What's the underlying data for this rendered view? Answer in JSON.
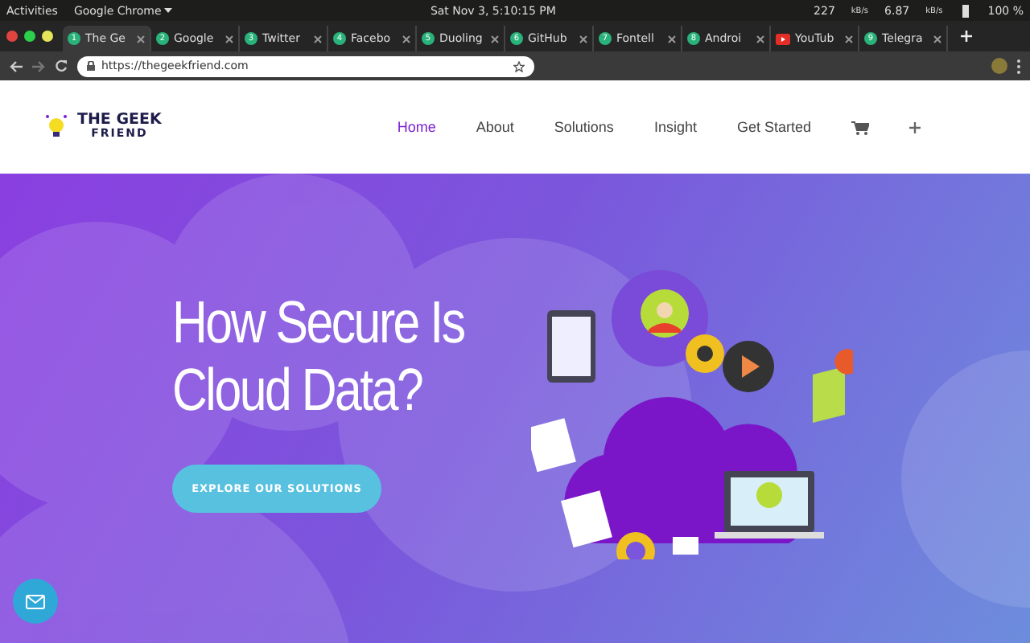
{
  "top_bar": {
    "activities": "Activities",
    "app": "Google Chrome",
    "clock": "Sat Nov  3,  5:10:15 PM",
    "down_speed": "227",
    "down_unit": "kB/s",
    "up_speed": "6.87",
    "up_unit": "kB/s",
    "battery": "100 %"
  },
  "tabs": [
    {
      "kind": "number",
      "badge": "1",
      "label": "The Ge",
      "selected": true
    },
    {
      "kind": "number",
      "badge": "2",
      "label": "Google",
      "selected": false
    },
    {
      "kind": "number",
      "badge": "3",
      "label": "Twitter",
      "selected": false
    },
    {
      "kind": "number",
      "badge": "4",
      "label": "Facebo",
      "selected": false
    },
    {
      "kind": "number",
      "badge": "5",
      "label": "Duoling",
      "selected": false
    },
    {
      "kind": "number",
      "badge": "6",
      "label": "GitHub",
      "selected": false
    },
    {
      "kind": "number",
      "badge": "7",
      "label": "Fontell",
      "selected": false
    },
    {
      "kind": "number",
      "badge": "8",
      "label": "Androi",
      "selected": false
    },
    {
      "kind": "video",
      "label": "YouTub",
      "selected": false
    },
    {
      "kind": "number",
      "badge": "9",
      "label": "Telegra",
      "selected": false
    }
  ],
  "address_bar": {
    "url": "https://thegeekfriend.com"
  },
  "site_nav": {
    "logo_line_1": "THE GEEK",
    "logo_line_2": "FRIEND",
    "items": [
      {
        "label": "Home",
        "selected": true
      },
      {
        "label": "About",
        "selected": false
      },
      {
        "label": "Solutions",
        "selected": false
      },
      {
        "label": "Insight",
        "selected": false
      },
      {
        "label": "Get Started",
        "selected": false
      }
    ]
  },
  "hero": {
    "heading_line_1": "How Secure Is",
    "heading_line_2": "Cloud Data?",
    "button": "EXPLORE OUR SOLUTIONS"
  }
}
